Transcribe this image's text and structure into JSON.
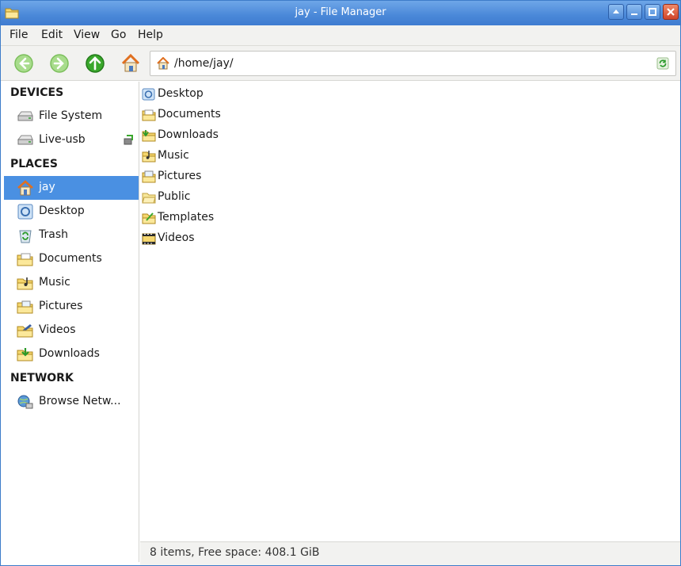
{
  "window": {
    "title": "jay - File Manager"
  },
  "menu": [
    "File",
    "Edit",
    "View",
    "Go",
    "Help"
  ],
  "location": {
    "path": "/home/jay/"
  },
  "sidebar": {
    "devices_header": "DEVICES",
    "devices": [
      {
        "label": "File System",
        "icon": "drive-icon"
      },
      {
        "label": "Live-usb",
        "icon": "usb-drive-icon"
      }
    ],
    "places_header": "PLACES",
    "places": [
      {
        "label": "jay",
        "icon": "home-icon",
        "selected": true
      },
      {
        "label": "Desktop",
        "icon": "desktop-icon"
      },
      {
        "label": "Trash",
        "icon": "trash-icon"
      },
      {
        "label": "Documents",
        "icon": "documents-folder-icon"
      },
      {
        "label": "Music",
        "icon": "music-folder-icon"
      },
      {
        "label": "Pictures",
        "icon": "pictures-folder-icon"
      },
      {
        "label": "Videos",
        "icon": "videos-folder-icon"
      },
      {
        "label": "Downloads",
        "icon": "downloads-folder-icon"
      }
    ],
    "network_header": "NETWORK",
    "network": [
      {
        "label": "Browse Netw...",
        "icon": "network-icon"
      }
    ]
  },
  "files": [
    {
      "label": "Desktop",
      "icon": "desktop-icon"
    },
    {
      "label": "Documents",
      "icon": "documents-folder-icon"
    },
    {
      "label": "Downloads",
      "icon": "downloads-folder-icon"
    },
    {
      "label": "Music",
      "icon": "music-folder-icon"
    },
    {
      "label": "Pictures",
      "icon": "pictures-folder-icon"
    },
    {
      "label": "Public",
      "icon": "public-folder-icon"
    },
    {
      "label": "Templates",
      "icon": "templates-folder-icon"
    },
    {
      "label": "Videos",
      "icon": "videos-folder-icon"
    }
  ],
  "status": {
    "text": "8 items, Free space: 408.1 GiB"
  },
  "colors": {
    "titlebar": "#4a88d8",
    "selection": "#4a90e2",
    "nav_green": "#3aa82c"
  }
}
